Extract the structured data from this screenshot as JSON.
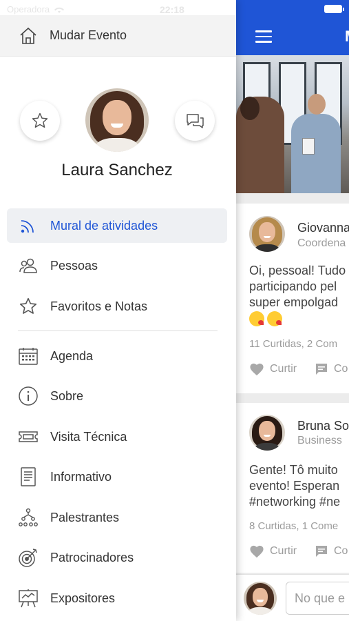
{
  "status_bar": {
    "carrier": "Operadora",
    "time": "22:18"
  },
  "drawer": {
    "header": {
      "label": "Mudar Evento",
      "icon": "home-icon"
    },
    "user": {
      "name": "Laura Sanchez"
    },
    "menu_primary": [
      {
        "label": "Mural de atividades",
        "icon": "rss-icon",
        "active": true
      },
      {
        "label": "Pessoas",
        "icon": "people-icon"
      },
      {
        "label": "Favoritos e Notas",
        "icon": "star-icon"
      }
    ],
    "menu_secondary": [
      {
        "label": "Agenda",
        "icon": "calendar-icon"
      },
      {
        "label": "Sobre",
        "icon": "info-icon"
      },
      {
        "label": "Visita Técnica",
        "icon": "ticket-icon"
      },
      {
        "label": "Informativo",
        "icon": "document-icon"
      },
      {
        "label": "Palestrantes",
        "icon": "speakers-icon"
      },
      {
        "label": "Patrocinadores",
        "icon": "target-icon"
      },
      {
        "label": "Expositores",
        "icon": "easel-icon"
      }
    ]
  },
  "feed": {
    "title": "M",
    "posts": [
      {
        "author": "Giovanna",
        "role": "Coordena",
        "text_lines": [
          "Oi, pessoal! Tudo",
          "participando pel",
          "super empolgad"
        ],
        "stats": "11 Curtidas, 2 Com",
        "like": "Curtir",
        "comment": "Co"
      },
      {
        "author": "Bruna So",
        "role": "Business",
        "text_lines": [
          "Gente! Tô muito",
          "evento! Esperan",
          "#networking #ne"
        ],
        "stats": "8 Curtidas, 1 Come",
        "like": "Curtir",
        "comment": "Co"
      }
    ],
    "composer": {
      "placeholder": "No que e"
    }
  },
  "colors": {
    "primary": "#1f55d6",
    "active_bg": "#eef0f3",
    "muted": "#9b9b9b"
  }
}
